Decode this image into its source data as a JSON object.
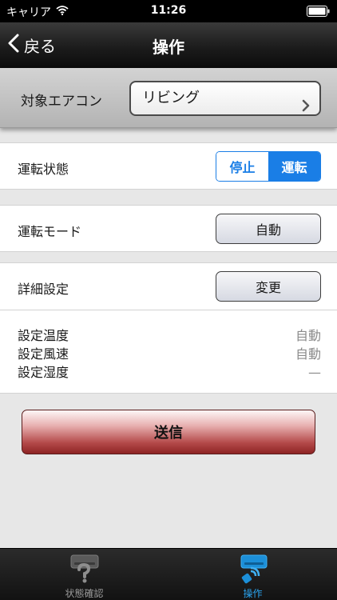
{
  "status_bar": {
    "carrier": "キャリア",
    "time": "11:26"
  },
  "nav": {
    "back_label": "戻る",
    "title": "操作"
  },
  "target": {
    "label": "対象エアコン",
    "value": "リビング"
  },
  "operation": {
    "label": "運転状態",
    "options": [
      "停止",
      "運転"
    ],
    "selected": "運転"
  },
  "mode": {
    "label": "運転モード",
    "button": "自動"
  },
  "detail": {
    "label": "詳細設定",
    "button": "変更",
    "settings": [
      {
        "label": "設定温度",
        "value": "自動"
      },
      {
        "label": "設定風速",
        "value": "自動"
      },
      {
        "label": "設定湿度",
        "value": "—"
      }
    ]
  },
  "send_label": "送信",
  "tabs": [
    {
      "label": "状態確認",
      "icon": "aircon-question-icon",
      "active": false
    },
    {
      "label": "操作",
      "icon": "aircon-remote-icon",
      "active": true
    }
  ],
  "colors": {
    "accent": "#1a7ee6",
    "tab_active": "#2aa3ee",
    "send": "#b44a4a"
  }
}
